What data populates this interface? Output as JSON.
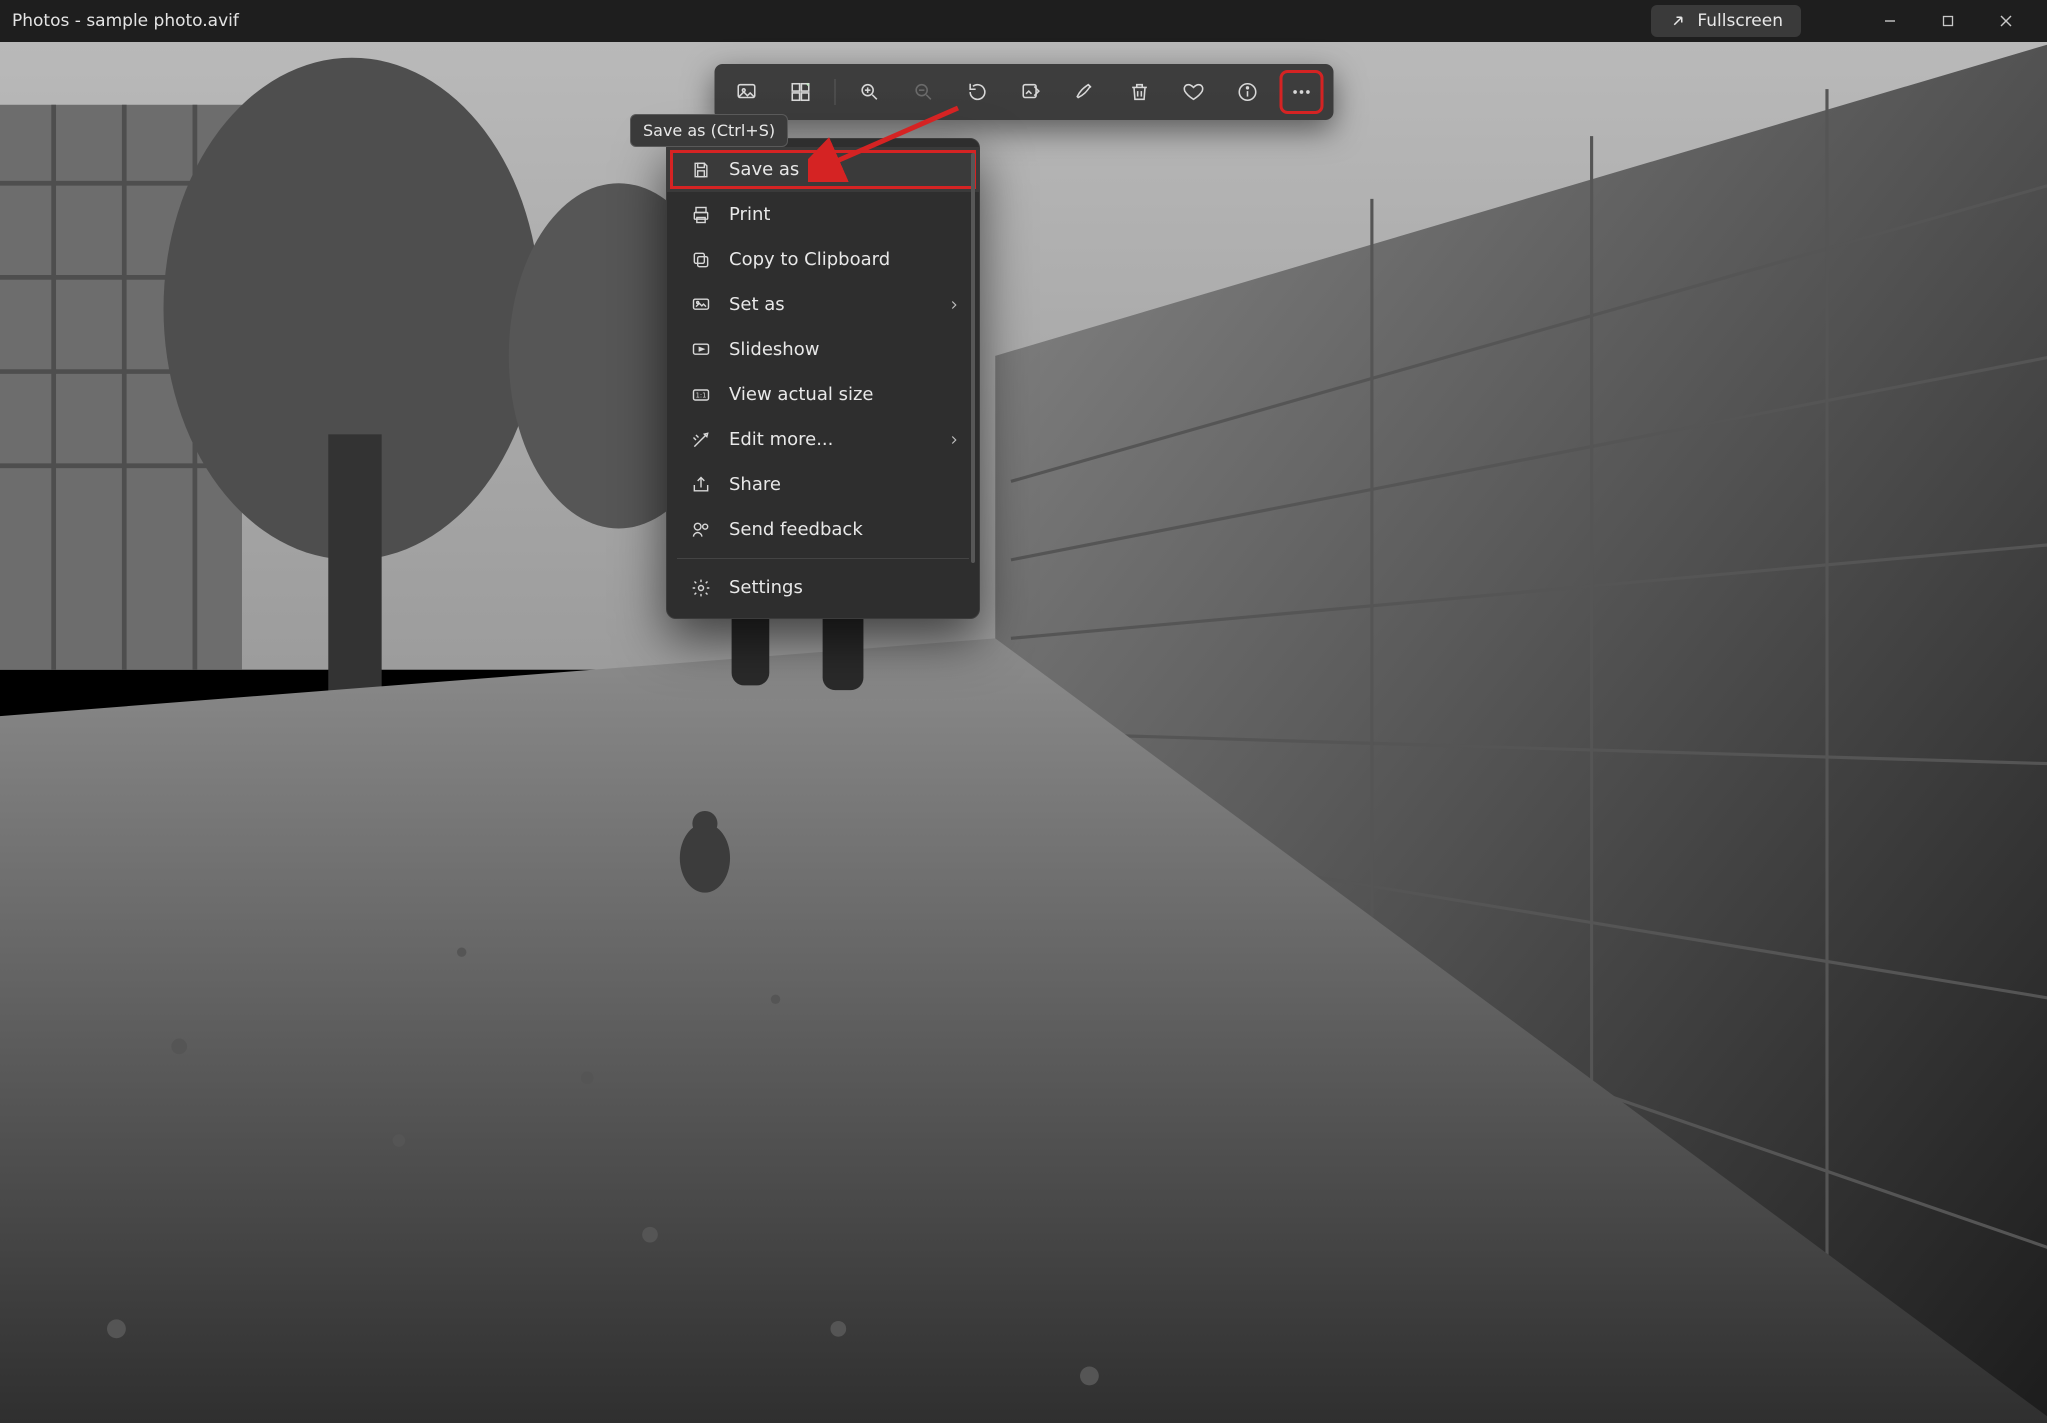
{
  "titlebar": {
    "app_name": "Photos",
    "separator": " - ",
    "file_name": "sample photo.avif",
    "fullscreen_label": "Fullscreen"
  },
  "toolbar": {
    "items": [
      {
        "name": "photo-view-icon"
      },
      {
        "name": "filmstrip-icon"
      },
      {
        "name": "zoom-in-icon"
      },
      {
        "name": "zoom-out-icon",
        "disabled": true
      },
      {
        "name": "rotate-icon"
      },
      {
        "name": "edit-image-icon"
      },
      {
        "name": "markup-icon"
      },
      {
        "name": "delete-icon"
      },
      {
        "name": "favorite-icon"
      },
      {
        "name": "info-icon"
      },
      {
        "name": "more-icon",
        "highlighted": true
      }
    ]
  },
  "tooltip": {
    "text": "Save as (Ctrl+S)"
  },
  "menu": {
    "items": [
      {
        "icon": "save-icon",
        "label": "Save as",
        "highlighted": true
      },
      {
        "icon": "print-icon",
        "label": "Print"
      },
      {
        "icon": "copy-icon",
        "label": "Copy to Clipboard"
      },
      {
        "icon": "set-as-icon",
        "label": "Set as",
        "submenu": true
      },
      {
        "icon": "slideshow-icon",
        "label": "Slideshow"
      },
      {
        "icon": "actual-size-icon",
        "label": "View actual size"
      },
      {
        "icon": "edit-more-icon",
        "label": "Edit more...",
        "submenu": true
      },
      {
        "icon": "share-icon",
        "label": "Share"
      },
      {
        "icon": "feedback-icon",
        "label": "Send feedback"
      },
      {
        "icon": "settings-icon",
        "label": "Settings"
      }
    ]
  },
  "annotation": {
    "more_button_highlight_color": "#d52323",
    "save_as_highlight_color": "#d52323",
    "arrow_color": "#d52323"
  }
}
